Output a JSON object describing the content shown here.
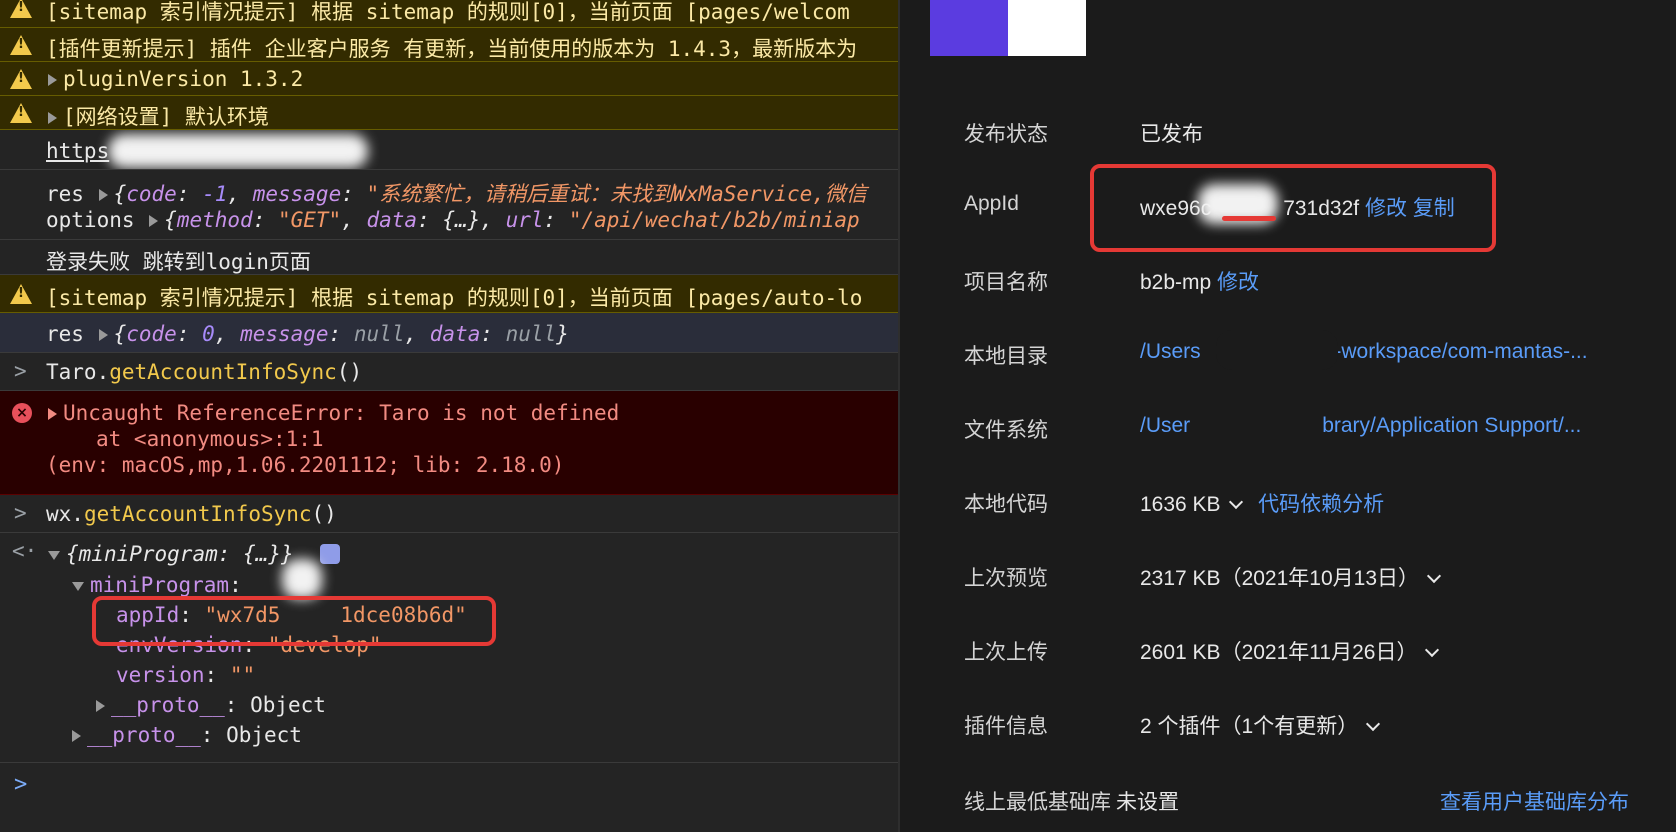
{
  "console": {
    "rows": [
      {
        "text": "[sitemap 索引情况提示] 根据 sitemap 的规则[0]，当前页面 [pages/welcom"
      },
      {
        "text": "[插件更新提示] 插件 企业客户服务 有更新，当前使用的版本为 1.4.3，最新版本为"
      },
      {
        "text": "pluginVersion 1.3.2"
      },
      {
        "text": "[网络设置] 默认环境"
      },
      {
        "text": "https"
      },
      {
        "res_key": "res",
        "res_code_key": "code",
        "res_code": "-1",
        "res_msg_key": "message",
        "res_msg": "\"系统繁忙，请稍后重试：未找到WxMaService,微信"
      },
      {
        "options_key": "options",
        "method_key": "method",
        "method": "\"GET\"",
        "data_key": "data",
        "data": "{…}",
        "url_key": "url",
        "url": "\"/api/wechat/b2b/miniap"
      },
      {
        "text": "登录失败 跳转到login页面"
      },
      {
        "text": "[sitemap 索引情况提示] 根据 sitemap 的规则[0]，当前页面 [pages/auto-lo"
      },
      {
        "res_key": "res",
        "code_key": "code",
        "code": "0",
        "message_key": "message",
        "message": "null",
        "data_key": "data",
        "data": "null"
      },
      {
        "obj": "Taro",
        "method": "getAccountInfoSync"
      },
      {
        "line1": "Uncaught ReferenceError: Taro is not defined",
        "line2": "at <anonymous>:1:1",
        "line3": "(env: macOS,mp,1.06.2201112; lib: 2.18.0)"
      },
      {
        "obj": "wx",
        "method": "getAccountInfoSync"
      },
      {
        "summary_key": "miniProgram",
        "summary_val": "{…}",
        "mp_key": "miniProgram",
        "appid_key": "appId",
        "appid_val": "\"wx7d5",
        "appid_val2": "1dce08b6d\"",
        "env_key": "envVersion",
        "env_val": "\"develop\"",
        "ver_key": "version",
        "ver_val": "\"\"",
        "proto_key": "__proto__",
        "proto_val": "Object"
      }
    ]
  },
  "panel": {
    "items": [
      {
        "label": "发布状态",
        "value": "已发布"
      },
      {
        "label": "AppId",
        "value_a": "wxe96c",
        "value_b": "731d32f",
        "link1": "修改",
        "link2": "复制"
      },
      {
        "label": "项目名称",
        "value": "b2b-mp",
        "link": "修改"
      },
      {
        "label": "本地目录",
        "value_a": "/Users",
        "value_b": "b-workspace/com-mantas-..."
      },
      {
        "label": "文件系统",
        "value_a": "/User",
        "value_b": "brary/Application Support/..."
      },
      {
        "label": "本地代码",
        "value": "1636 KB",
        "link": "代码依赖分析"
      },
      {
        "label": "上次预览",
        "value": "2317 KB（2021年10月13日）"
      },
      {
        "label": "上次上传",
        "value": "2601 KB（2021年11月26日）"
      },
      {
        "label": "插件信息",
        "value": "2 个插件（1个有更新）"
      },
      {
        "label": "线上最低基础库",
        "value": "未设置",
        "link": "查看用户基础库分布"
      }
    ]
  },
  "colors": {
    "accent_purple": "#5b3ce0",
    "highlight_red": "#e53935",
    "link_blue": "#5a9cf8"
  }
}
